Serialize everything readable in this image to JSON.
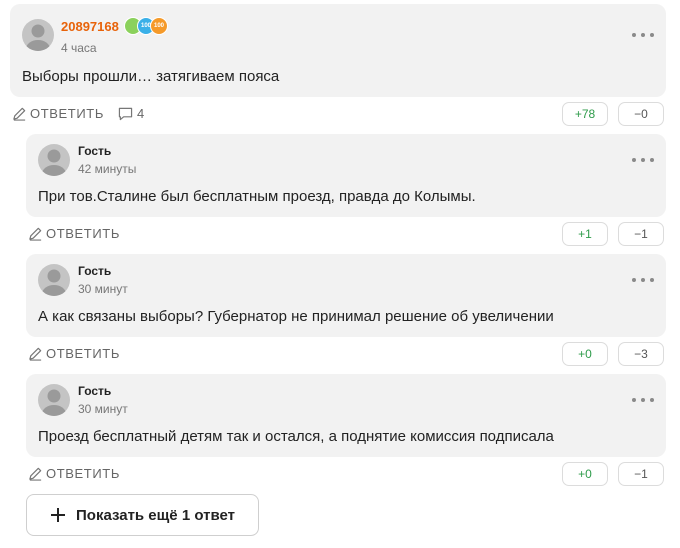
{
  "colors": {
    "card_bg": "#f2f2f2",
    "author_highlight": "#e8630a",
    "vote_plus": "#2e9b4a",
    "vote_minus": "#555555"
  },
  "comments": [
    {
      "author": "20897168",
      "time": "4 часа",
      "text": "Выборы прошли… затягиваем пояса",
      "reply_label": "ОТВЕТИТЬ",
      "replies_count": "4",
      "votes_up": "+78",
      "votes_down": "−0",
      "badges": [
        "badge-green-icon",
        "badge-blue-100-icon",
        "badge-orange-100-icon"
      ]
    },
    {
      "author": "Гость",
      "time": "42 минуты",
      "text": "При тов.Сталине был бесплатным проезд, правда до Колымы.",
      "reply_label": "ОТВЕТИТЬ",
      "votes_up": "+1",
      "votes_down": "−1"
    },
    {
      "author": "Гость",
      "time": "30 минут",
      "text": "А как связаны выборы? Губернатор не принимал решение об увеличении",
      "reply_label": "ОТВЕТИТЬ",
      "votes_up": "+0",
      "votes_down": "−3"
    },
    {
      "author": "Гость",
      "time": "30 минут",
      "text": "Проезд бесплатный детям так и остался, а поднятие комиссия подписала",
      "reply_label": "ОТВЕТИТЬ",
      "votes_up": "+0",
      "votes_down": "−1"
    }
  ],
  "badges_text": [
    "",
    "100",
    "100"
  ],
  "show_more_label": "Показать ещё 1 ответ"
}
